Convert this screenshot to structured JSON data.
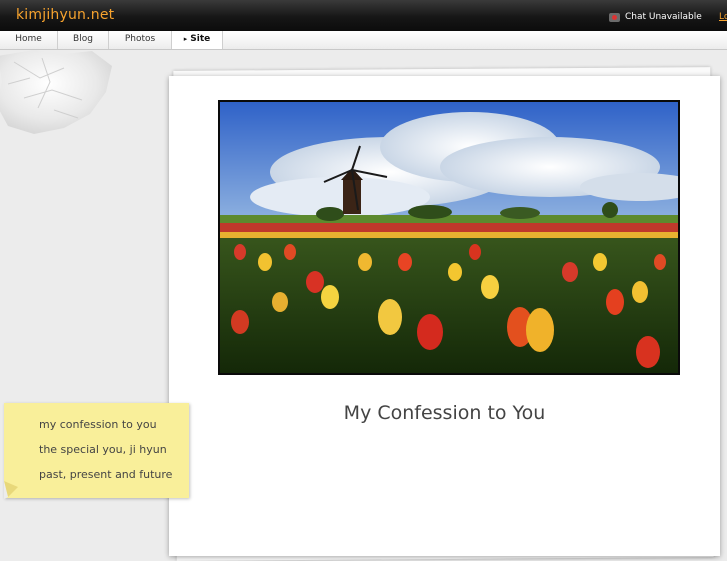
{
  "header": {
    "site_title": "kimjihyun.net",
    "chat_status": "Chat Unavailable",
    "login_partial": "Lo"
  },
  "nav": {
    "tabs": [
      {
        "label": "Home",
        "active": false
      },
      {
        "label": "Blog",
        "active": false
      },
      {
        "label": "Photos",
        "active": false
      },
      {
        "label": "Site",
        "active": true
      }
    ]
  },
  "main": {
    "heading": "My Confession to You"
  },
  "note": {
    "lines": [
      "my confession to you",
      "the special you, ji hyun",
      "past, present and future"
    ]
  },
  "colors": {
    "accent": "#f7a32e",
    "note": "#f9ef9a",
    "topbar": "#161616"
  }
}
